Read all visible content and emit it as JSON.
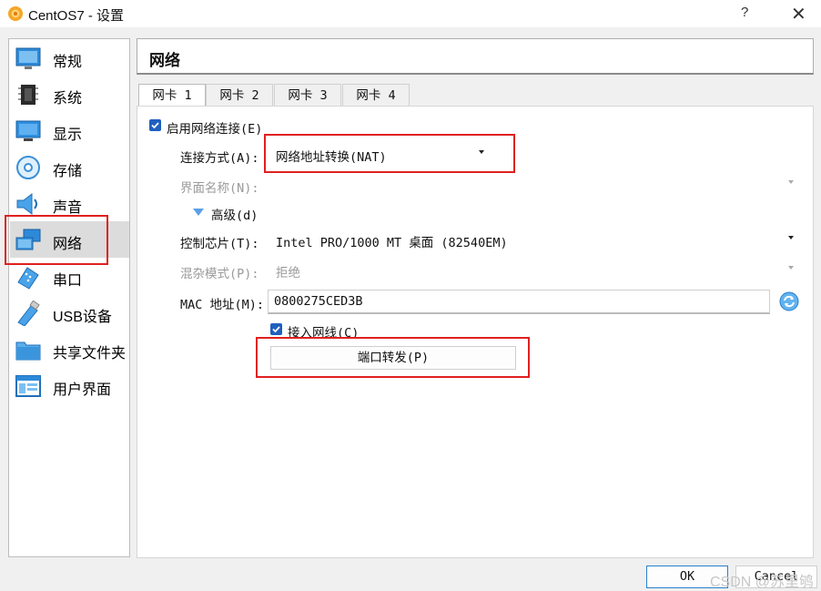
{
  "window": {
    "title": "CentOS7 - 设置",
    "help_label": "?",
    "close_label": "✕"
  },
  "sidebar": {
    "items": [
      {
        "label": "常规",
        "icon": "general-icon"
      },
      {
        "label": "系统",
        "icon": "system-chip-icon"
      },
      {
        "label": "显示",
        "icon": "display-monitor-icon"
      },
      {
        "label": "存储",
        "icon": "storage-disc-icon"
      },
      {
        "label": "声音",
        "icon": "audio-speaker-icon"
      },
      {
        "label": "网络",
        "icon": "network-icon",
        "selected": true
      },
      {
        "label": "串口",
        "icon": "serial-port-icon"
      },
      {
        "label": "USB设备",
        "icon": "usb-icon"
      },
      {
        "label": "共享文件夹",
        "icon": "shared-folder-icon"
      },
      {
        "label": "用户界面",
        "icon": "user-interface-icon"
      }
    ]
  },
  "header": {
    "title": "网络"
  },
  "tabs": [
    {
      "label": "网卡 1",
      "active": true
    },
    {
      "label": "网卡 2"
    },
    {
      "label": "网卡 3"
    },
    {
      "label": "网卡 4"
    }
  ],
  "adapter": {
    "enable_label": "启用网络连接(E)",
    "enable_checked": true,
    "attached_label": "连接方式(A):",
    "attached_value": "网络地址转换(NAT)",
    "name_label": "界面名称(N):",
    "name_value": "",
    "advanced_label": "高级(d)",
    "chip_label": "控制芯片(T):",
    "chip_value": "Intel PRO/1000 MT 桌面 (82540EM)",
    "promisc_label": "混杂模式(P):",
    "promisc_value": "拒绝",
    "mac_label": "MAC 地址(M):",
    "mac_value": "0800275CED3B",
    "cable_label": "接入网线(C)",
    "cable_checked": true,
    "port_forward_label": "端口转发(P)"
  },
  "footer": {
    "ok_label": "OK",
    "cancel_label": "Cancel"
  },
  "watermark": "CSDN @苏里鸲",
  "colors": {
    "accent": "#1f5fbf",
    "highlight_box": "#e02020",
    "selected_row": "#dcdcdc"
  }
}
